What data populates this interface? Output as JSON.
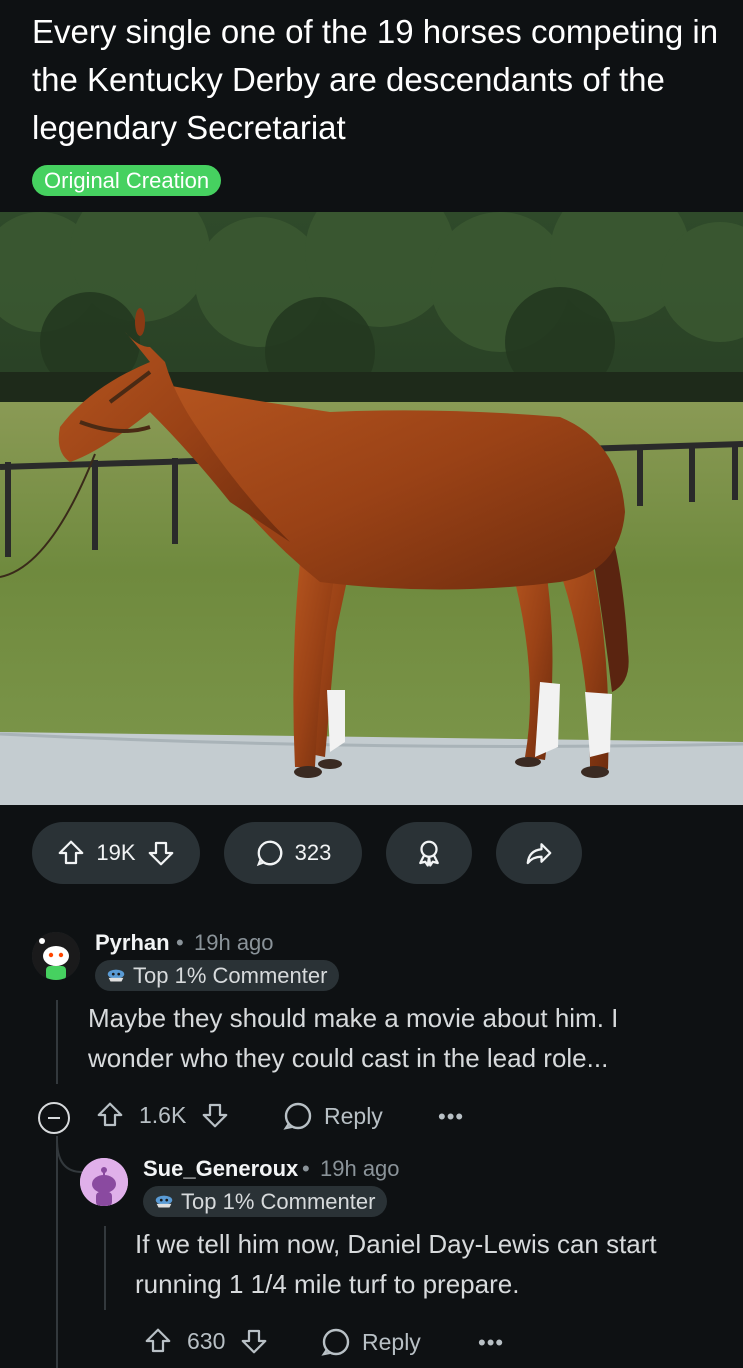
{
  "post": {
    "title": "Every single one of the 19 horses competing in the Kentucky Derby are descendants of the legendary Secretariat",
    "flair": "Original Creation",
    "image_subject": "chestnut horse standing in a paddock",
    "upvotes": "19K",
    "comments": "323"
  },
  "comments": [
    {
      "username": "Pyrhan",
      "time": "19h ago",
      "badge": "Top 1% Commenter",
      "body": "Maybe they should make a movie about him. I wonder who they could cast in the lead role...",
      "score": "1.6K",
      "reply_label": "Reply"
    },
    {
      "username": "Sue_Generoux",
      "time": "19h ago",
      "badge": "Top 1% Commenter",
      "body": "If we tell him now, Daniel Day-Lewis can start running 1 1/4 mile turf to prepare.",
      "score": "630",
      "reply_label": "Reply"
    }
  ],
  "separator": "•",
  "colors": {
    "background": "#0e1113",
    "flair": "#46d160",
    "pill": "#2a3236"
  }
}
